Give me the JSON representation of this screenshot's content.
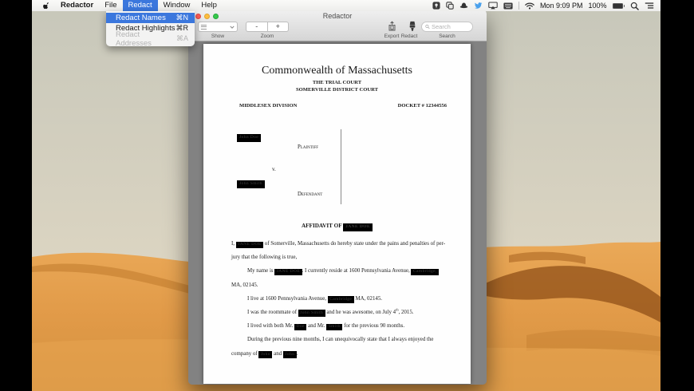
{
  "menubar": {
    "apple_icon": "apple-logo",
    "items": [
      {
        "label": "Redactor"
      },
      {
        "label": "File"
      },
      {
        "label": "Redact"
      },
      {
        "label": "Window"
      },
      {
        "label": "Help"
      }
    ],
    "active_item": "Redact",
    "status": {
      "clock": "Mon 9:09 PM",
      "battery_percent": "100%"
    }
  },
  "menu_dropdown": {
    "items": [
      {
        "label": "Redact Names",
        "shortcut": "⌘N",
        "state": "highlighted"
      },
      {
        "label": "Redact Highlights",
        "shortcut": "⌘R",
        "state": "normal"
      },
      {
        "label": "Redact Addresses",
        "shortcut": "⌘A",
        "state": "disabled"
      }
    ]
  },
  "window": {
    "title": "Redactor",
    "toolbar": {
      "show_label": "Show",
      "zoom_label": "Zoom",
      "zoom_minus": "-",
      "zoom_plus": "+",
      "export_label": "Export",
      "redact_label": "Redact",
      "search_label": "Search",
      "search_placeholder": "Search",
      "search_value": ""
    }
  },
  "document": {
    "title": "Commonwealth of Massachusetts",
    "subtitle1": "THE TRIAL COURT",
    "subtitle2": "SOMERVILLE DISTRICT COURT",
    "division": "MIDDLESEX DIVISION",
    "docket": "DOCKET # 12344556",
    "caption": {
      "plaintiff_name_redacted": "John Doe",
      "plaintiff_label": "Plaintiff",
      "versus": "v.",
      "defendant_name_redacted": "John Smith",
      "defendant_label": "Defendant"
    },
    "affidavit_title": "AFFIDAVIT OF",
    "affidavit_name_redacted": "JANE DOE",
    "body_lines": [
      {
        "indent": 0,
        "segments": [
          {
            "t": "text",
            "v": "I, "
          },
          {
            "t": "red",
            "v": "JANE DOE"
          },
          {
            "t": "text",
            "v": " of Somerville, Massachusetts do hereby state under the pains and penalties of per-"
          }
        ]
      },
      {
        "indent": 0,
        "segments": [
          {
            "t": "text",
            "v": "jury that the following is true,"
          }
        ]
      },
      {
        "indent": 1,
        "segments": [
          {
            "t": "text",
            "v": "My name is "
          },
          {
            "t": "red",
            "v": "JANE DOE"
          },
          {
            "t": "text",
            "v": ". I currently reside at 1600 Pennsylvania Avenue, "
          },
          {
            "t": "red",
            "v": "Cambridge,"
          }
        ]
      },
      {
        "indent": 0,
        "segments": [
          {
            "t": "text",
            "v": "MA, 02145."
          }
        ]
      },
      {
        "indent": 1,
        "segments": [
          {
            "t": "text",
            "v": "I live at 1600 Pennsylvania Avenue, "
          },
          {
            "t": "red",
            "v": "Cambridge"
          },
          {
            "t": "text",
            "v": " MA, 02145."
          }
        ]
      },
      {
        "indent": 1,
        "segments": [
          {
            "t": "text",
            "v": "I was the roommate of "
          },
          {
            "t": "red",
            "v": "John Smith"
          },
          {
            "t": "text",
            "v": " and he was awesome, on July 4"
          },
          {
            "t": "sup",
            "v": "th"
          },
          {
            "t": "text",
            "v": ", 2015."
          }
        ]
      },
      {
        "indent": 1,
        "segments": [
          {
            "t": "text",
            "v": "I lived with both Mr. "
          },
          {
            "t": "red",
            "v": "Doe"
          },
          {
            "t": "text",
            "v": " and Mr. "
          },
          {
            "t": "red",
            "v": "Smith"
          },
          {
            "t": "text",
            "v": " for the previous 90 months."
          }
        ]
      },
      {
        "indent": 1,
        "segments": [
          {
            "t": "text",
            "v": "During the previous nine months, I can unequivocally state that I always enjoyed the"
          }
        ]
      },
      {
        "indent": 0,
        "segments": [
          {
            "t": "text",
            "v": "company of "
          },
          {
            "t": "red",
            "v": "John"
          },
          {
            "t": "text",
            "v": " and "
          },
          {
            "t": "red",
            "v": "John"
          },
          {
            "t": "text",
            "v": "."
          }
        ]
      }
    ]
  },
  "colors": {
    "menu_highlight_blue": "#3b77dd",
    "redaction_black": "#000000",
    "window_chrome_gray": "#d9d9d9",
    "content_gray": "#828282",
    "sky_haze": "#cac9ba",
    "dune_orange": "#e29c4e",
    "dune_shadow_brown": "#8a4a14",
    "traffic_red": "#fc5b57",
    "traffic_yellow": "#fdbe3f",
    "traffic_green": "#34c84a",
    "twitter_blue": "#4aa1ec"
  }
}
